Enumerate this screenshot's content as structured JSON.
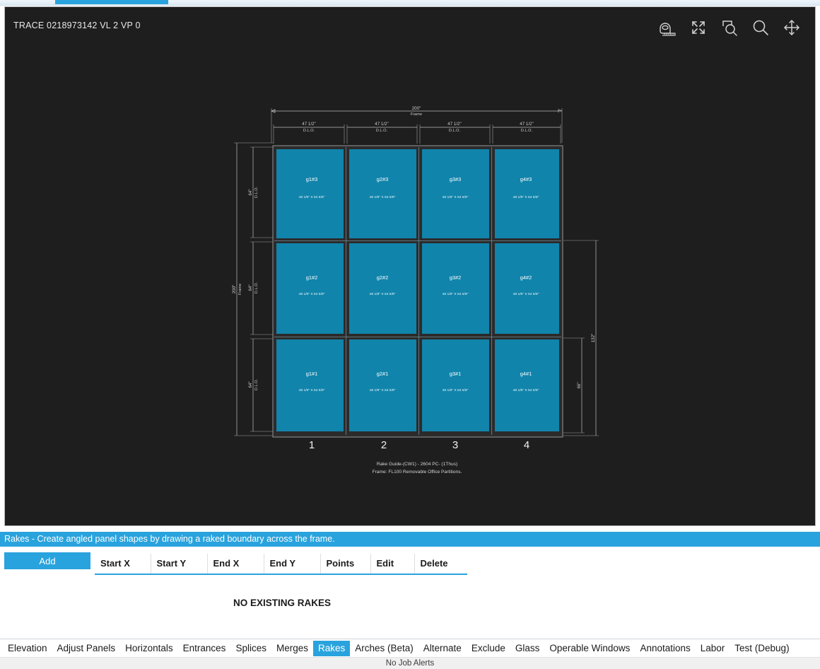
{
  "window": {
    "trace_label": "TRACE 0218973142  VL 2  VP 0"
  },
  "toolbar": {
    "icons": [
      {
        "name": "tape-measure-icon",
        "title": "Measure"
      },
      {
        "name": "expand-arrows-icon",
        "title": "Fit to screen"
      },
      {
        "name": "zoom-region-icon",
        "title": "Zoom to region"
      },
      {
        "name": "magnifier-icon",
        "title": "Zoom"
      },
      {
        "name": "pan-move-icon",
        "title": "Pan"
      }
    ]
  },
  "drawing": {
    "top_overall": {
      "value": "200\"",
      "label": "Frame"
    },
    "top_segments": [
      {
        "value": "47 1/2\"",
        "label": "D.L.O."
      },
      {
        "value": "47 1/2\"",
        "label": "D.L.O."
      },
      {
        "value": "47 1/2\"",
        "label": "D.L.O."
      },
      {
        "value": "47 1/2\"",
        "label": "D.L.O."
      }
    ],
    "left_overall": {
      "value": "200\"",
      "label": "Frame"
    },
    "left_segments": [
      {
        "value": "64\"",
        "label": "D.L.O."
      },
      {
        "value": "64\"",
        "label": "D.L.O."
      },
      {
        "value": "64\"",
        "label": "D.L.O."
      }
    ],
    "right_overall": "132\"",
    "right_segment": "66\"",
    "column_numbers": [
      "1",
      "2",
      "3",
      "4"
    ],
    "panels": [
      {
        "label": "g1#3",
        "size": "48 1/8\" X 64 5/8\"",
        "col": 1,
        "row": 3
      },
      {
        "label": "g2#3",
        "size": "48 1/8\" X 64 5/8\"",
        "col": 2,
        "row": 3
      },
      {
        "label": "g3#3",
        "size": "48 1/8\" X 64 5/8\"",
        "col": 3,
        "row": 3
      },
      {
        "label": "g4#3",
        "size": "48 1/8\" X 64 5/8\"",
        "col": 4,
        "row": 3
      },
      {
        "label": "g1#2",
        "size": "48 1/8\" X 64 5/8\"",
        "col": 1,
        "row": 2
      },
      {
        "label": "g2#2",
        "size": "48 1/8\" X 64 5/8\"",
        "col": 2,
        "row": 2
      },
      {
        "label": "g3#2",
        "size": "48 1/8\" X 64 5/8\"",
        "col": 3,
        "row": 2
      },
      {
        "label": "g4#2",
        "size": "48 1/8\" X 64 5/8\"",
        "col": 4,
        "row": 2
      },
      {
        "label": "g1#1",
        "size": "48 1/8\" X 64 5/8\"",
        "col": 1,
        "row": 1
      },
      {
        "label": "g2#1",
        "size": "48 1/8\" X 64 5/8\"",
        "col": 2,
        "row": 1
      },
      {
        "label": "g3#1",
        "size": "48 1/8\" X 64 5/8\"",
        "col": 3,
        "row": 1
      },
      {
        "label": "g4#1",
        "size": "48 1/8\" X 64 5/8\"",
        "col": 4,
        "row": 1
      }
    ],
    "caption_line1": "Rake Guide-(CW1) - 2604 PC-  (1Thus)",
    "caption_line2": "Frame: FL100 Removable Office Partitions.",
    "colors": {
      "glass": "#1184ab",
      "mullion": "#2b2b2b",
      "canvas_bg": "#1e1e1e",
      "dimension": "#bdbdbd"
    }
  },
  "section": {
    "header": "Rakes - Create angled panel shapes by drawing a raked boundary across the frame.",
    "add_label": "Add",
    "columns": [
      "Start X",
      "Start Y",
      "End X",
      "End Y",
      "Points",
      "Edit",
      "Delete"
    ],
    "empty_message": "NO EXISTING RAKES"
  },
  "tabs": {
    "active": "Rakes",
    "items": [
      "Elevation",
      "Adjust Panels",
      "Horizontals",
      "Entrances",
      "Splices",
      "Merges",
      "Rakes",
      "Arches (Beta)",
      "Alternate",
      "Exclude",
      "Glass",
      "Operable Windows",
      "Annotations",
      "Labor",
      "Test (Debug)"
    ]
  },
  "status": {
    "message": "No Job Alerts"
  },
  "theme": {
    "accent": "#29a3dd"
  }
}
